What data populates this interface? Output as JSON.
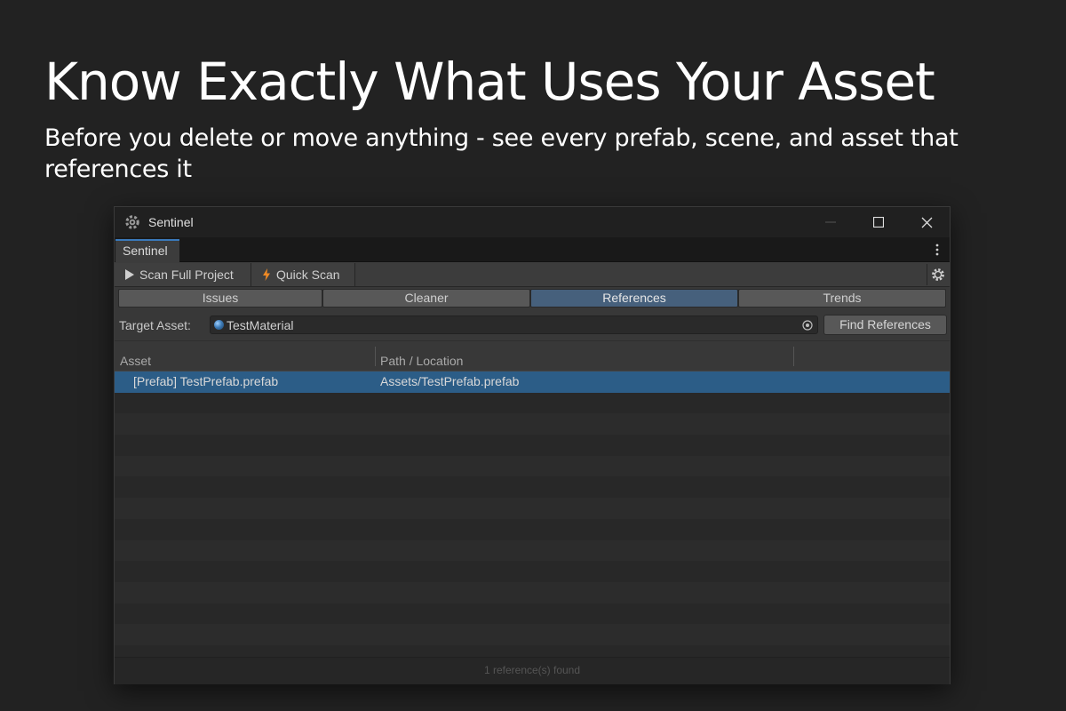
{
  "hero": {
    "title": "Know Exactly What Uses Your Asset",
    "subtitle": "Before you delete or move anything - see every prefab, scene, and asset that references it"
  },
  "window": {
    "title": "Sentinel",
    "icons": {
      "app": "unity-gear-icon",
      "minimize": "minimize-icon",
      "maximize": "maximize-icon",
      "close": "close-icon"
    },
    "doc_tab": "Sentinel",
    "toolbar": {
      "scan_full_label": "Scan Full Project",
      "quick_scan_label": "Quick Scan",
      "scan_full_icon": "play-icon",
      "quick_scan_icon": "lightning-icon",
      "settings_icon": "gear-icon"
    },
    "tabs": [
      {
        "label": "Issues",
        "active": false
      },
      {
        "label": "Cleaner",
        "active": false
      },
      {
        "label": "References",
        "active": true
      },
      {
        "label": "Trends",
        "active": false
      }
    ],
    "target": {
      "label": "Target Asset:",
      "value": "TestMaterial",
      "value_icon": "material-sphere-icon",
      "picker_icon": "object-picker-icon",
      "find_label": "Find References"
    },
    "table": {
      "columns": [
        "Asset",
        "Path / Location"
      ],
      "rows": [
        {
          "asset": "[Prefab] TestPrefab.prefab",
          "path": "Assets/TestPrefab.prefab",
          "selected": true
        }
      ]
    },
    "status": "1 reference(s) found"
  },
  "colors": {
    "accent_tab": "#3a79bb",
    "selected_row": "#2c5d87",
    "active_segment": "#46607c",
    "lightning": "#f08a24"
  }
}
